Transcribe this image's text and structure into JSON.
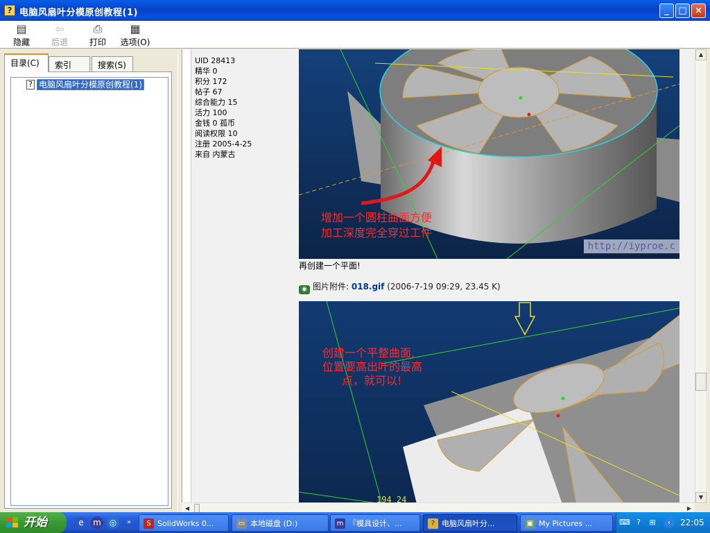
{
  "window": {
    "title": "电脑风扇叶分模原创教程(1)",
    "buttons": {
      "minimize": "_",
      "maximize": "□",
      "close": "×"
    }
  },
  "toolbar": {
    "hide": "隐藏",
    "back": "后退",
    "print": "打印",
    "options": "选项(O)"
  },
  "tabs": [
    {
      "label": "目录(C)"
    },
    {
      "label": "索引(N)"
    },
    {
      "label": "搜索(S)"
    }
  ],
  "tree": {
    "item": "电脑风扇叶分模原创教程(1)"
  },
  "userinfo": [
    "UID 28413",
    "精华 0",
    "积分 172",
    "帖子 67",
    "综合能力 15",
    "活力 100",
    "金钱 0 孤币",
    "阅读权限 10",
    "注册 2005-4-25",
    "来自 内蒙古"
  ],
  "image1": {
    "annotation_line1": "增加一个圆柱曲面方便",
    "annotation_line2": "加工深度完全穿过工件",
    "watermark": "http://iyproe.c"
  },
  "caption": "再创建一个平面!",
  "attachment": {
    "prefix": "图片附件: ",
    "filename": "018.gif",
    "meta": " (2006-7-19 09:29, 23.45 K)"
  },
  "image2": {
    "annotation_line1": "创建一个平整曲面,",
    "annotation_line2": "位置要高出叶的最高",
    "annotation_line3": "点，就可以!",
    "bottom_text": "194 24"
  },
  "taskbar": {
    "start": "开始",
    "tasks": [
      {
        "label": "SolidWorks 0..."
      },
      {
        "label": "本地磁盘 (D:)"
      },
      {
        "label": "『模具设计、..."
      },
      {
        "label": "电脑风扇叶分..."
      },
      {
        "label": "My Pictures ..."
      }
    ],
    "clock": "22:05"
  }
}
